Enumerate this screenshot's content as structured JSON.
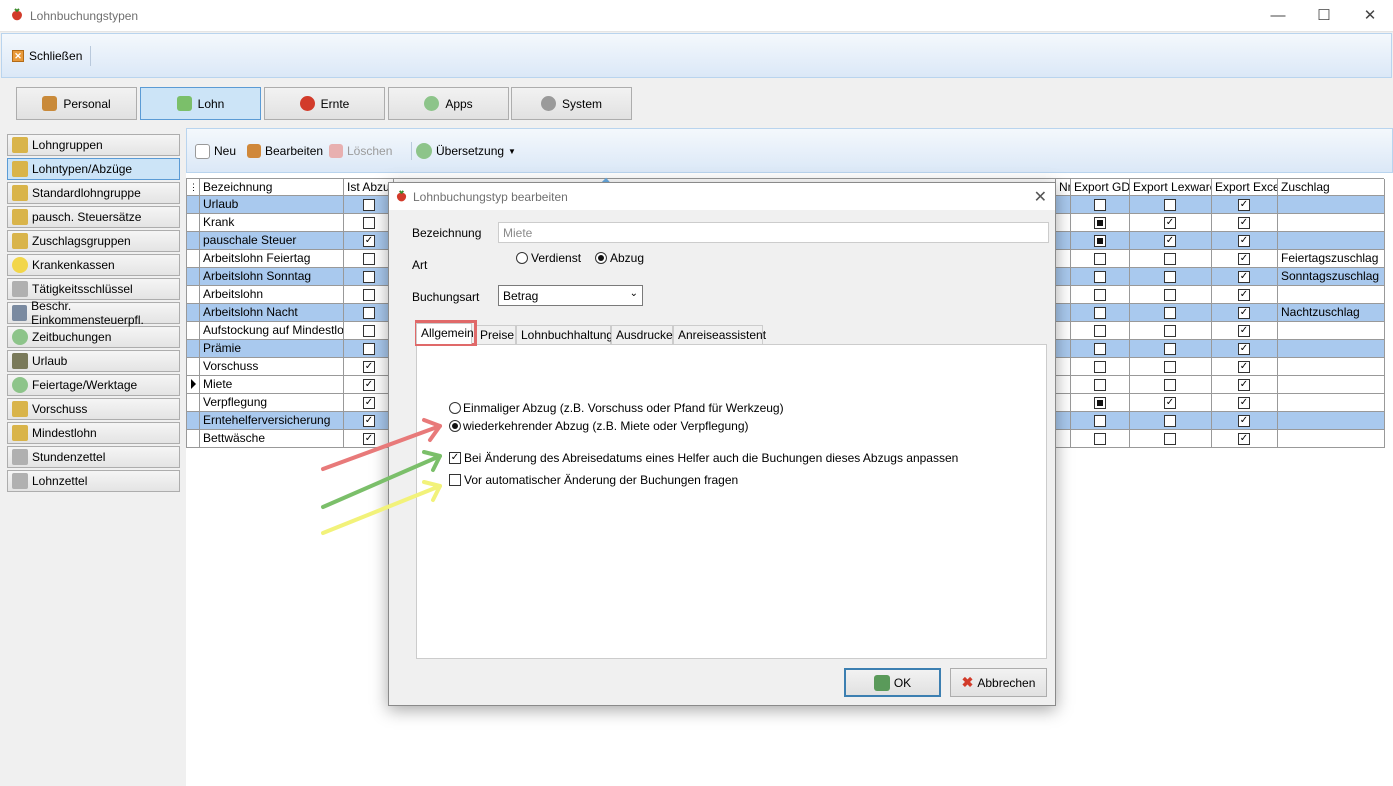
{
  "window": {
    "title": "Lohnbuchungstypen",
    "minimize_icon": "minimize-icon",
    "maximize_icon": "maximize-icon",
    "close_icon": "close-icon"
  },
  "top_toolbar": {
    "close_label": "Schließen"
  },
  "modules": [
    {
      "label": "Personal",
      "icon": "people-icon",
      "active": false
    },
    {
      "label": "Lohn",
      "icon": "money-icon",
      "active": true
    },
    {
      "label": "Ernte",
      "icon": "strawberry-icon",
      "active": false
    },
    {
      "label": "Apps",
      "icon": "apps-icon",
      "active": false
    },
    {
      "label": "System",
      "icon": "gear-icon",
      "active": false
    }
  ],
  "sidebar": {
    "items": [
      {
        "label": "Lohngruppen"
      },
      {
        "label": "Lohntypen/Abzüge",
        "active": true
      },
      {
        "label": "Standardlohngruppe"
      },
      {
        "label": "pausch. Steuersätze"
      },
      {
        "label": "Zuschlagsgruppen"
      },
      {
        "label": "Krankenkassen"
      },
      {
        "label": "Tätigkeitsschlüssel"
      },
      {
        "label": "Beschr. Einkommensteuerpfl."
      },
      {
        "label": "Zeitbuchungen"
      },
      {
        "label": "Urlaub"
      },
      {
        "label": "Feiertage/Werktage"
      },
      {
        "label": "Vorschuss"
      },
      {
        "label": "Mindestlohn"
      },
      {
        "label": "Stundenzettel"
      },
      {
        "label": "Lohnzettel"
      }
    ]
  },
  "sub_toolbar": {
    "new_label": "Neu",
    "edit_label": "Bearbeiten",
    "delete_label": "Löschen",
    "translate_label": "Übersetzung"
  },
  "grid": {
    "columns": {
      "name": "Bezeichnung",
      "is_deduction": "Ist Abzug",
      "nr": "Nr.",
      "export_gdi": "Export GDI",
      "export_lexware": "Export Lexware",
      "export_excel": "Export Excel",
      "surcharge": "Zuschlag"
    },
    "rows": [
      {
        "name": "Urlaub",
        "abzug": false,
        "gdi": false,
        "lex": false,
        "excel": true,
        "zuschlag": "",
        "sel": true
      },
      {
        "name": "Krank",
        "abzug": false,
        "gdi": "fill",
        "lex": true,
        "excel": true,
        "zuschlag": "",
        "sel": false
      },
      {
        "name": "pauschale Steuer",
        "abzug": true,
        "gdi": "fill",
        "lex": true,
        "excel": true,
        "zuschlag": "",
        "sel": true
      },
      {
        "name": "Arbeitslohn Feiertag",
        "abzug": false,
        "gdi": false,
        "lex": false,
        "excel": true,
        "zuschlag": "Feiertagszuschlag",
        "sel": false
      },
      {
        "name": "Arbeitslohn Sonntag",
        "abzug": false,
        "gdi": false,
        "lex": false,
        "excel": true,
        "zuschlag": "Sonntagszuschlag",
        "sel": true
      },
      {
        "name": "Arbeitslohn",
        "abzug": false,
        "gdi": false,
        "lex": false,
        "excel": true,
        "zuschlag": "",
        "sel": false
      },
      {
        "name": "Arbeitslohn Nacht",
        "abzug": false,
        "gdi": false,
        "lex": false,
        "excel": true,
        "zuschlag": "Nachtzuschlag",
        "sel": true
      },
      {
        "name": "Aufstockung auf Mindestlohn",
        "abzug": false,
        "gdi": false,
        "lex": false,
        "excel": true,
        "zuschlag": "",
        "sel": false
      },
      {
        "name": "Prämie",
        "abzug": false,
        "gdi": false,
        "lex": false,
        "excel": true,
        "zuschlag": "",
        "sel": true
      },
      {
        "name": "Vorschuss",
        "abzug": true,
        "gdi": false,
        "lex": false,
        "excel": true,
        "zuschlag": "",
        "sel": false
      },
      {
        "name": "Miete",
        "abzug": true,
        "gdi": false,
        "lex": false,
        "excel": true,
        "zuschlag": "",
        "sel": false,
        "current": true
      },
      {
        "name": "Verpflegung",
        "abzug": true,
        "gdi": "fill",
        "lex": true,
        "excel": true,
        "zuschlag": "",
        "sel": false
      },
      {
        "name": "Erntehelferversicherung",
        "abzug": true,
        "gdi": false,
        "lex": false,
        "excel": true,
        "zuschlag": "",
        "sel": true
      },
      {
        "name": "Bettwäsche",
        "abzug": true,
        "gdi": false,
        "lex": false,
        "excel": true,
        "zuschlag": "",
        "sel": false
      }
    ]
  },
  "dialog": {
    "title": "Lohnbuchungstyp bearbeiten",
    "name_label": "Bezeichnung",
    "name_value": "Miete",
    "art_label": "Art",
    "art_option_earnings": "Verdienst",
    "art_option_deduction": "Abzug",
    "art_selected": "Abzug",
    "booking_type_label": "Buchungsart",
    "booking_type_value": "Betrag",
    "tabs": [
      "Allgemein",
      "Preise",
      "Lohnbuchhaltung",
      "Ausdrucke",
      "Anreiseassistent"
    ],
    "active_tab": "Allgemein",
    "option_one_time": "Einmaliger Abzug (z.B. Vorschuss oder Pfand für Werkzeug)",
    "option_recurring": "wiederkehrender Abzug (z.B. Miete oder Verpflegung)",
    "recurring_selected": true,
    "check_adjust": "Bei Änderung des Abreisedatums eines Helfer auch die Buchungen dieses Abzugs anpassen",
    "check_adjust_value": true,
    "check_ask": "Vor automatischer Änderung der Buchungen fragen",
    "check_ask_value": false,
    "ok_label": "OK",
    "cancel_label": "Abbrechen"
  },
  "annotations": {
    "red": "#e87a7a",
    "green": "#7bbf6a",
    "yellow": "#f2f27a",
    "blue": "#6aaee6"
  }
}
